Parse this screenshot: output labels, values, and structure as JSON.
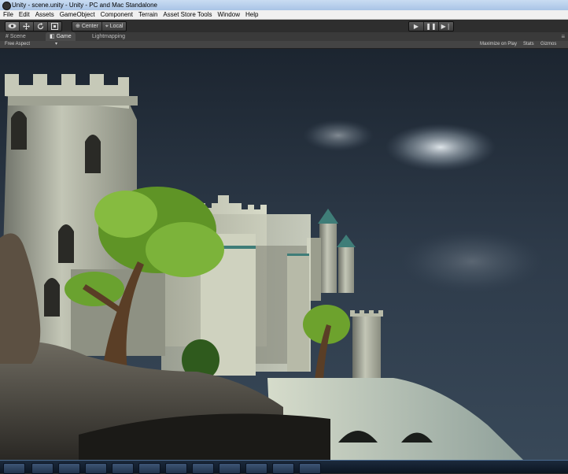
{
  "window": {
    "title": "Unity - scene.unity - Unity - PC and Mac Standalone"
  },
  "menu": {
    "items": [
      {
        "label": "File"
      },
      {
        "label": "Edit"
      },
      {
        "label": "Assets"
      },
      {
        "label": "GameObject"
      },
      {
        "label": "Component"
      },
      {
        "label": "Terrain"
      },
      {
        "label": "Asset Store Tools"
      },
      {
        "label": "Window"
      },
      {
        "label": "Help"
      }
    ]
  },
  "toolbar": {
    "pivot_center_label": "Center",
    "pivot_local_label": "Local"
  },
  "tabs": {
    "scene_label": "Scene",
    "game_label": "Game",
    "lightmapping_label": "Lightmapping"
  },
  "game_view": {
    "aspect_label": "Free Aspect",
    "maximize_label": "Maximize on Play",
    "stats_label": "Stats",
    "gizmos_label": "Gizmos"
  },
  "colors": {
    "sky": "#2a3645",
    "stone": "#b9bcae",
    "roof": "#3f7d78",
    "foliage": "#6fa12a"
  }
}
